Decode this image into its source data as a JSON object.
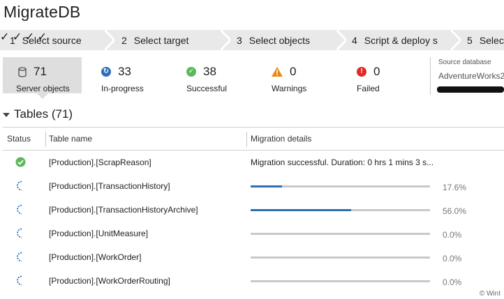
{
  "app": {
    "title": "MigrateDB"
  },
  "steps": [
    {
      "num": "1",
      "label": "Select source",
      "check": "✓"
    },
    {
      "num": "2",
      "label": "Select target",
      "check": "✓"
    },
    {
      "num": "3",
      "label": "Select objects",
      "check": "✓"
    },
    {
      "num": "4",
      "label": "Script & deploy s",
      "check": "✓"
    },
    {
      "num": "5",
      "label": "Select"
    }
  ],
  "summary": {
    "server_objects": {
      "count": "71",
      "label": "Server objects",
      "icon": "database-icon"
    },
    "in_progress": {
      "count": "33",
      "label": "In-progress",
      "icon": "sync-icon",
      "color": "#2d6fb5"
    },
    "successful": {
      "count": "38",
      "label": "Successful",
      "icon": "check-circle-icon",
      "color": "#5cb85c"
    },
    "warnings": {
      "count": "0",
      "label": "Warnings",
      "icon": "warning-icon",
      "color": "#e8891a"
    },
    "failed": {
      "count": "0",
      "label": "Failed",
      "icon": "error-icon",
      "color": "#e02a2a"
    }
  },
  "source": {
    "label": "Source database",
    "value": "AdventureWorks2"
  },
  "tables": {
    "title": "Tables (71)",
    "columns": {
      "status": "Status",
      "name": "Table name",
      "details": "Migration details"
    },
    "rows": [
      {
        "status": "success",
        "name": "[Production].[ScrapReason]",
        "details": "Migration successful. Duration: 0 hrs 1 mins 3 s..."
      },
      {
        "status": "progress",
        "name": "[Production].[TransactionHistory]",
        "progress": 17.6,
        "pct": "17.6%"
      },
      {
        "status": "progress",
        "name": "[Production].[TransactionHistoryArchive]",
        "progress": 56.0,
        "pct": "56.0%"
      },
      {
        "status": "progress",
        "name": "[Production].[UnitMeasure]",
        "progress": 0.0,
        "pct": "0.0%"
      },
      {
        "status": "progress",
        "name": "[Production].[WorkOrder]",
        "progress": 0.0,
        "pct": "0.0%"
      },
      {
        "status": "progress",
        "name": "[Production].[WorkOrderRouting]",
        "progress": 0.0,
        "pct": "0.0%"
      }
    ]
  },
  "watermark": "© WinI"
}
